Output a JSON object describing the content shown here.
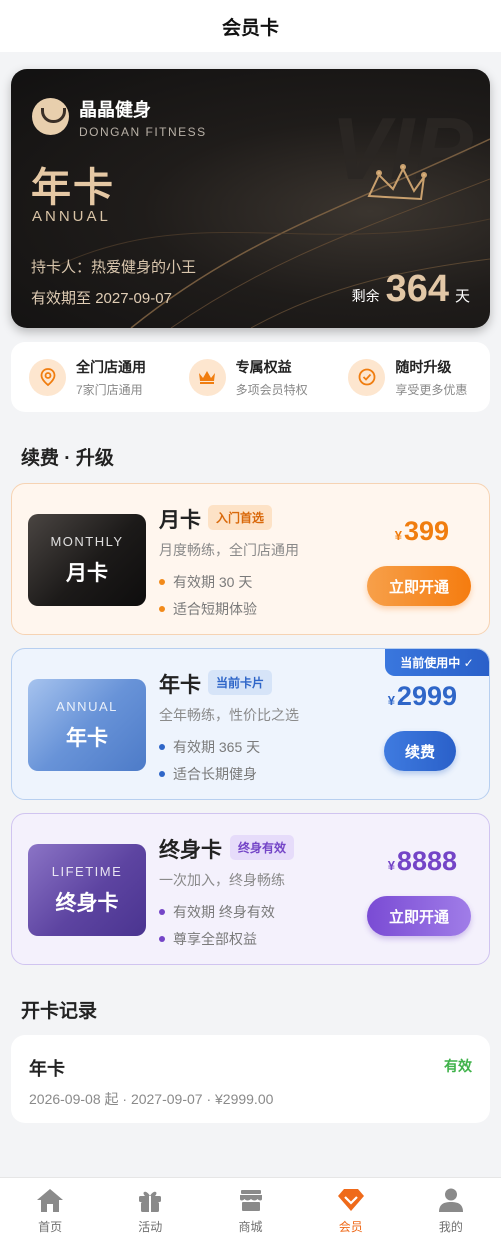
{
  "header": {
    "title": "会员卡"
  },
  "hero": {
    "brand_name": "晶晶健身",
    "brand_en": "DONGAN FITNESS",
    "card_type": "年卡",
    "card_type_en": "ANNUAL",
    "watermark": "VIP",
    "holder": "持卡人：热爱健身的小王",
    "expire_label": "有效期至",
    "expire_date": "2027-09-07",
    "remain_label": "剩余",
    "remain_days": "364",
    "remain_unit": "天"
  },
  "benefits": [
    {
      "icon": "location-pin-icon",
      "title": "全门店通用",
      "subtitle": "7家门店通用"
    },
    {
      "icon": "crown-icon",
      "title": "专属权益",
      "subtitle": "多项会员特权"
    },
    {
      "icon": "check-circle-icon",
      "title": "随时升级",
      "subtitle": "享受更多优惠"
    }
  ],
  "sections": {
    "renew": "续费 · 升级",
    "records": "开卡记录"
  },
  "plans": {
    "monthly": {
      "thumb_en": "MONTHLY",
      "thumb_zh": "月卡",
      "name": "月卡",
      "tag": "入门首选",
      "desc": "月度畅练，全门店通用",
      "features": [
        "有效期 30 天",
        "适合短期体验"
      ],
      "currency": "¥",
      "price": "399",
      "button": "立即开通"
    },
    "annual": {
      "thumb_en": "ANNUAL",
      "thumb_zh": "年卡",
      "name": "年卡",
      "tag": "当前卡片",
      "desc": "全年畅练，性价比之选",
      "features": [
        "有效期 365 天",
        "适合长期健身"
      ],
      "currency": "¥",
      "price": "2999",
      "button": "续费",
      "badge": "当前使用中 ✓"
    },
    "lifetime": {
      "thumb_en": "LIFETIME",
      "thumb_zh": "终身卡",
      "name": "终身卡",
      "tag": "终身有效",
      "desc": "一次加入，终身畅练",
      "features": [
        "有效期 终身有效",
        "尊享全部权益"
      ],
      "currency": "¥",
      "price": "8888",
      "button": "立即开通"
    }
  },
  "record": {
    "name": "年卡",
    "status": "有效",
    "meta": "2026-09-08 起 · 2027-09-07 · ¥2999.00"
  },
  "tabs": [
    {
      "icon": "home-icon",
      "label": "首页",
      "active": false
    },
    {
      "icon": "gift-icon",
      "label": "活动",
      "active": false
    },
    {
      "icon": "store-icon",
      "label": "商城",
      "active": false
    },
    {
      "icon": "diamond-icon",
      "label": "会员",
      "active": true
    },
    {
      "icon": "user-icon",
      "label": "我的",
      "active": false
    }
  ],
  "colors": {
    "accent": "#ef6a1a",
    "gold": "#e2c7a6",
    "blue": "#2f66c8",
    "purple": "#7445c7",
    "valid": "#3fb24a"
  }
}
